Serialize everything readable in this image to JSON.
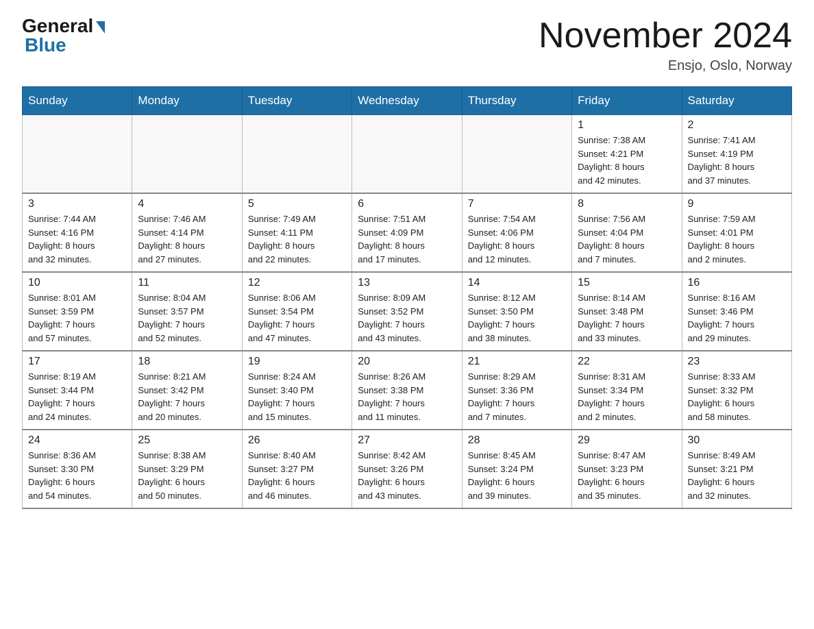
{
  "logo": {
    "general": "General",
    "blue": "Blue"
  },
  "header": {
    "month_year": "November 2024",
    "location": "Ensjo, Oslo, Norway"
  },
  "days_of_week": [
    "Sunday",
    "Monday",
    "Tuesday",
    "Wednesday",
    "Thursday",
    "Friday",
    "Saturday"
  ],
  "weeks": [
    [
      {
        "day": "",
        "info": ""
      },
      {
        "day": "",
        "info": ""
      },
      {
        "day": "",
        "info": ""
      },
      {
        "day": "",
        "info": ""
      },
      {
        "day": "",
        "info": ""
      },
      {
        "day": "1",
        "info": "Sunrise: 7:38 AM\nSunset: 4:21 PM\nDaylight: 8 hours\nand 42 minutes."
      },
      {
        "day": "2",
        "info": "Sunrise: 7:41 AM\nSunset: 4:19 PM\nDaylight: 8 hours\nand 37 minutes."
      }
    ],
    [
      {
        "day": "3",
        "info": "Sunrise: 7:44 AM\nSunset: 4:16 PM\nDaylight: 8 hours\nand 32 minutes."
      },
      {
        "day": "4",
        "info": "Sunrise: 7:46 AM\nSunset: 4:14 PM\nDaylight: 8 hours\nand 27 minutes."
      },
      {
        "day": "5",
        "info": "Sunrise: 7:49 AM\nSunset: 4:11 PM\nDaylight: 8 hours\nand 22 minutes."
      },
      {
        "day": "6",
        "info": "Sunrise: 7:51 AM\nSunset: 4:09 PM\nDaylight: 8 hours\nand 17 minutes."
      },
      {
        "day": "7",
        "info": "Sunrise: 7:54 AM\nSunset: 4:06 PM\nDaylight: 8 hours\nand 12 minutes."
      },
      {
        "day": "8",
        "info": "Sunrise: 7:56 AM\nSunset: 4:04 PM\nDaylight: 8 hours\nand 7 minutes."
      },
      {
        "day": "9",
        "info": "Sunrise: 7:59 AM\nSunset: 4:01 PM\nDaylight: 8 hours\nand 2 minutes."
      }
    ],
    [
      {
        "day": "10",
        "info": "Sunrise: 8:01 AM\nSunset: 3:59 PM\nDaylight: 7 hours\nand 57 minutes."
      },
      {
        "day": "11",
        "info": "Sunrise: 8:04 AM\nSunset: 3:57 PM\nDaylight: 7 hours\nand 52 minutes."
      },
      {
        "day": "12",
        "info": "Sunrise: 8:06 AM\nSunset: 3:54 PM\nDaylight: 7 hours\nand 47 minutes."
      },
      {
        "day": "13",
        "info": "Sunrise: 8:09 AM\nSunset: 3:52 PM\nDaylight: 7 hours\nand 43 minutes."
      },
      {
        "day": "14",
        "info": "Sunrise: 8:12 AM\nSunset: 3:50 PM\nDaylight: 7 hours\nand 38 minutes."
      },
      {
        "day": "15",
        "info": "Sunrise: 8:14 AM\nSunset: 3:48 PM\nDaylight: 7 hours\nand 33 minutes."
      },
      {
        "day": "16",
        "info": "Sunrise: 8:16 AM\nSunset: 3:46 PM\nDaylight: 7 hours\nand 29 minutes."
      }
    ],
    [
      {
        "day": "17",
        "info": "Sunrise: 8:19 AM\nSunset: 3:44 PM\nDaylight: 7 hours\nand 24 minutes."
      },
      {
        "day": "18",
        "info": "Sunrise: 8:21 AM\nSunset: 3:42 PM\nDaylight: 7 hours\nand 20 minutes."
      },
      {
        "day": "19",
        "info": "Sunrise: 8:24 AM\nSunset: 3:40 PM\nDaylight: 7 hours\nand 15 minutes."
      },
      {
        "day": "20",
        "info": "Sunrise: 8:26 AM\nSunset: 3:38 PM\nDaylight: 7 hours\nand 11 minutes."
      },
      {
        "day": "21",
        "info": "Sunrise: 8:29 AM\nSunset: 3:36 PM\nDaylight: 7 hours\nand 7 minutes."
      },
      {
        "day": "22",
        "info": "Sunrise: 8:31 AM\nSunset: 3:34 PM\nDaylight: 7 hours\nand 2 minutes."
      },
      {
        "day": "23",
        "info": "Sunrise: 8:33 AM\nSunset: 3:32 PM\nDaylight: 6 hours\nand 58 minutes."
      }
    ],
    [
      {
        "day": "24",
        "info": "Sunrise: 8:36 AM\nSunset: 3:30 PM\nDaylight: 6 hours\nand 54 minutes."
      },
      {
        "day": "25",
        "info": "Sunrise: 8:38 AM\nSunset: 3:29 PM\nDaylight: 6 hours\nand 50 minutes."
      },
      {
        "day": "26",
        "info": "Sunrise: 8:40 AM\nSunset: 3:27 PM\nDaylight: 6 hours\nand 46 minutes."
      },
      {
        "day": "27",
        "info": "Sunrise: 8:42 AM\nSunset: 3:26 PM\nDaylight: 6 hours\nand 43 minutes."
      },
      {
        "day": "28",
        "info": "Sunrise: 8:45 AM\nSunset: 3:24 PM\nDaylight: 6 hours\nand 39 minutes."
      },
      {
        "day": "29",
        "info": "Sunrise: 8:47 AM\nSunset: 3:23 PM\nDaylight: 6 hours\nand 35 minutes."
      },
      {
        "day": "30",
        "info": "Sunrise: 8:49 AM\nSunset: 3:21 PM\nDaylight: 6 hours\nand 32 minutes."
      }
    ]
  ]
}
